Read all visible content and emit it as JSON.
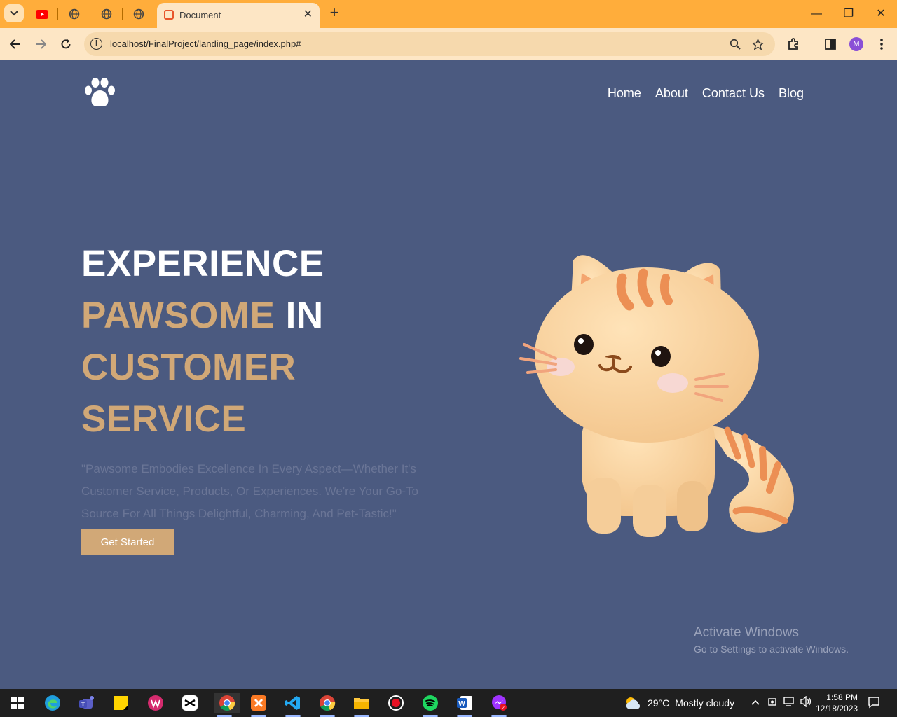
{
  "browser": {
    "tab_title": "Document",
    "tab_close": "✕",
    "new_tab": "+",
    "url": "localhost/FinalProject/landing_page/index.php#",
    "profile_initial": "M",
    "window": {
      "minimize": "—",
      "restore": "❐",
      "close": "✕"
    }
  },
  "site": {
    "nav": [
      "Home",
      "About",
      "Contact Us",
      "Blog"
    ],
    "hero": {
      "line1": "EXPERIENCE",
      "line2_gold": "PAWSOME",
      "line2_white": "IN",
      "line3": "CUSTOMER",
      "line4": "SERVICE",
      "description": "\"Pawsome Embodies Excellence In Every Aspect—Whether It's Customer Service, Products, Or Experiences. We're Your Go-To Source For All Things Delightful, Charming, And Pet-Tastic!\"",
      "cta": "Get Started"
    },
    "colors": {
      "background": "#4b5a80",
      "accent": "#d1a877",
      "text": "#ffffff"
    }
  },
  "watermark": {
    "title": "Activate Windows",
    "subtitle": "Go to Settings to activate Windows."
  },
  "taskbar": {
    "weather_temp": "29°C",
    "weather_desc": "Mostly cloudy",
    "time": "1:58 PM",
    "date": "12/18/2023"
  }
}
